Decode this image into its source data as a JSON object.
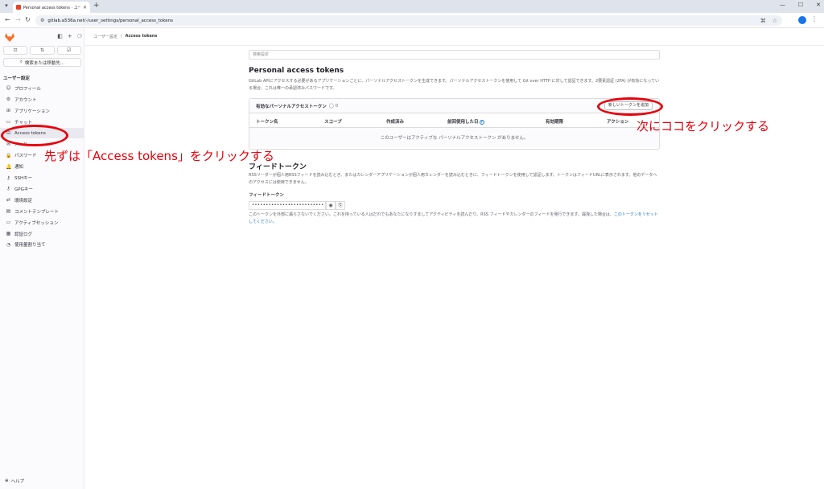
{
  "browser": {
    "tab_title": "Personal access tokens · ユーザー設定",
    "new_tab": "+",
    "url": "gitlab.a536a.net/-/user_settings/personal_access_tokens",
    "window_buttons": [
      "—",
      "☐",
      "✕"
    ]
  },
  "sidebar": {
    "nav_buttons": [
      "⊡",
      "⇅",
      "☑"
    ],
    "search_label": "検索または移動先...",
    "section_title": "ユーザー設定",
    "items": [
      {
        "label": "プロフィール",
        "icon": "profile-icon",
        "glyph": "☺"
      },
      {
        "label": "アカウント",
        "icon": "account-icon",
        "glyph": "⚙"
      },
      {
        "label": "アプリケーション",
        "icon": "applications-icon",
        "glyph": "⊞"
      },
      {
        "label": "チャット",
        "icon": "chat-icon",
        "glyph": "▭"
      },
      {
        "label": "Access tokens",
        "icon": "token-icon",
        "glyph": "⊟",
        "active": true
      },
      {
        "label": "メール",
        "icon": "mail-icon",
        "glyph": "✉"
      },
      {
        "label": "パスワード",
        "icon": "lock-icon",
        "glyph": "🔒"
      },
      {
        "label": "通知",
        "icon": "bell-icon",
        "glyph": "🔔"
      },
      {
        "label": "SSHキー",
        "icon": "key-icon",
        "glyph": "⚷"
      },
      {
        "label": "GPGキー",
        "icon": "gpg-key-icon",
        "glyph": "⚷"
      },
      {
        "label": "環境設定",
        "icon": "preferences-icon",
        "glyph": "⇄"
      },
      {
        "label": "コメントテンプレート",
        "icon": "comment-icon",
        "glyph": "▤"
      },
      {
        "label": "アクティブセッション",
        "icon": "monitor-icon",
        "glyph": "▭"
      },
      {
        "label": "認証ログ",
        "icon": "log-icon",
        "glyph": "▦"
      },
      {
        "label": "使用量割り当て",
        "icon": "usage-icon",
        "glyph": "◔"
      }
    ],
    "help_label": "ヘルプ"
  },
  "breadcrumb": {
    "parent": "ユーザー設定",
    "separator": "/",
    "current": "Access tokens"
  },
  "settings_search_placeholder": "検索設定",
  "pat": {
    "title": "Personal access tokens",
    "description": "GitLab APIにアクセスする必要があるアプリケーションごとに、パーソナルアクセストークンを生成できます。パーソナルアクセストークンを使用して Git over HTTP に対して認証できます。2要素認証 (2FA) が有効になっている場合、これは唯一の承認済みパスワードです。",
    "card_title": "有効なパーソナルアクセストークン",
    "count": "0",
    "add_button": "新しいトークンを追加",
    "columns": [
      "トークン名",
      "スコープ",
      "作成済み",
      "前回使用した日",
      "有効期限",
      "アクション"
    ],
    "empty_message": "このユーザーはアクティブな パーソナルアクセストークン がありません。"
  },
  "feed": {
    "title": "フィードトークン",
    "description": "RSSリーダーが個人用RSSフィードを読み込むとき、またはカレンダーアプリケーションが個人用カレンダーを読み込むときに、フィードトークンを使用して認証します。トークンはフィードURLに表示されます。他のデータへのアクセスには使用できません。",
    "label": "フィードトークン",
    "masked_value": "••••••••••••••••••••••••••",
    "note": "このトークンを外部に漏らさないでください。これを持っている人はだれでもあなたになりすましてアクティビティを読んだり、RSS フィードやカレンダーのフィードを発行できます。漏洩した場合は、",
    "reset_link": "このトークンをリセットしてください。"
  },
  "annotations": {
    "first": "先ずは「Access tokens」をクリックする",
    "second": "次にココをクリックする",
    "color": "#e8000b"
  }
}
